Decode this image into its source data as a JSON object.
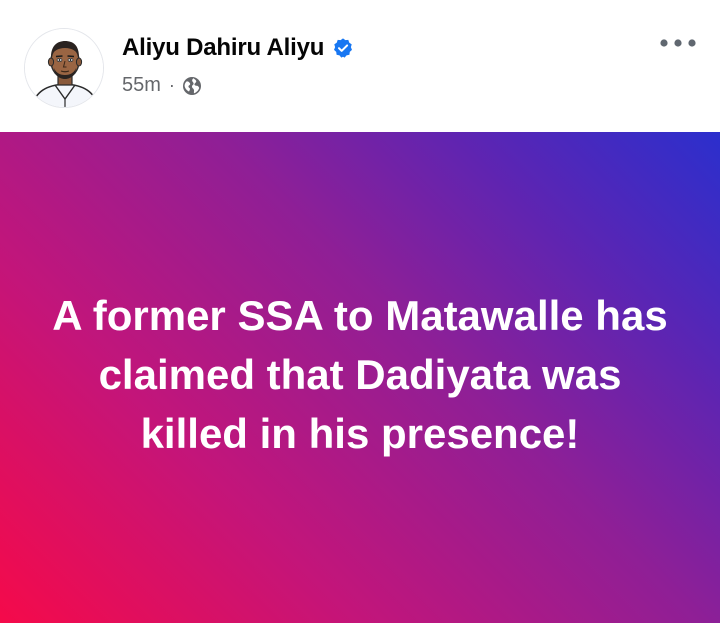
{
  "post": {
    "author": {
      "name": "Aliyu Dahiru Aliyu",
      "verified": true,
      "avatar_icon": "profile-avatar-illustration"
    },
    "meta": {
      "time": "55m",
      "separator": "·",
      "audience_icon": "globe-icon"
    },
    "more_icon": "more-options-icon",
    "banner": {
      "text": "A former SSA to Matawalle has claimed that Dadiyata was killed in his presence!",
      "gradient_colors": [
        "#f50a4a",
        "#8f1f96",
        "#2b2fcd"
      ]
    }
  },
  "colors": {
    "name": "#050505",
    "meta": "#65676b",
    "verified_badge": "#1877f2"
  }
}
